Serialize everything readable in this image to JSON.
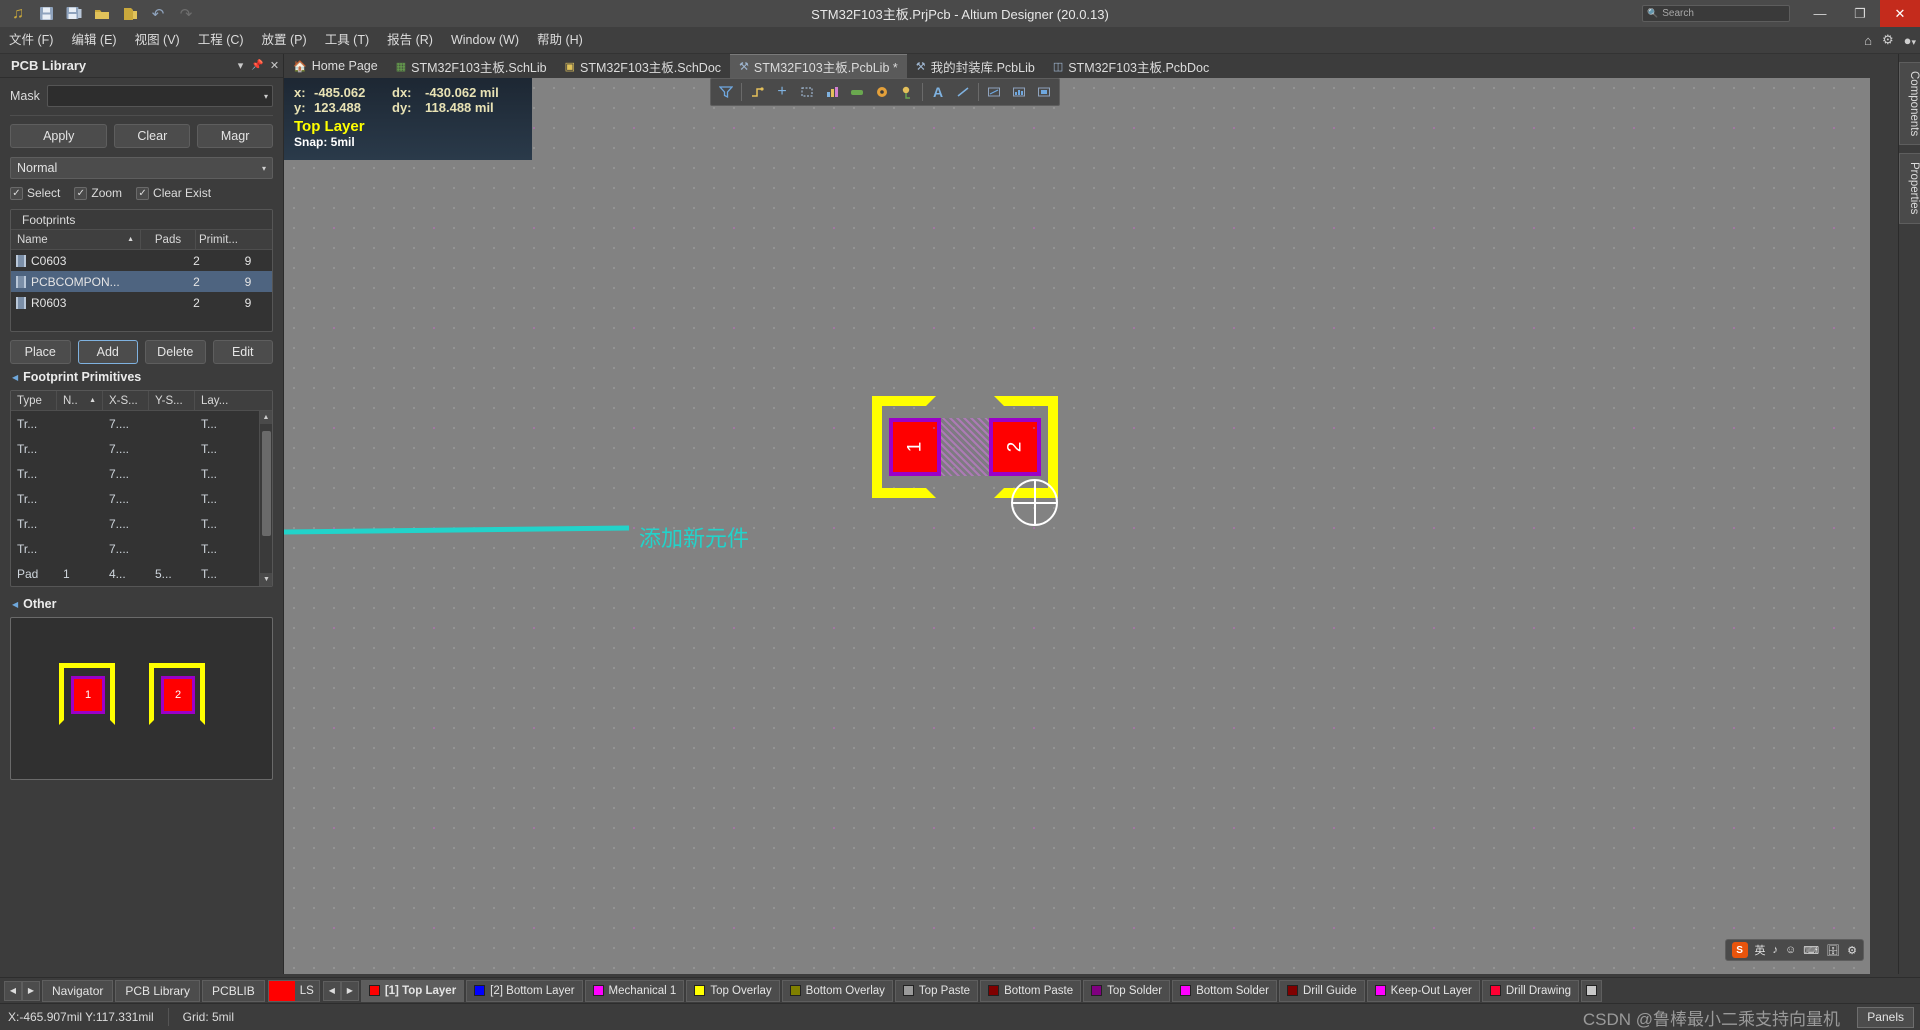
{
  "titlebar": {
    "title": "STM32F103主板.PrjPcb - Altium Designer (20.0.13)",
    "icons": [
      "altium-logo-icon",
      "save-icon",
      "save-all-icon",
      "open-folder-icon",
      "open-project-icon",
      "undo-icon",
      "redo-icon"
    ],
    "icon_glyphs": [
      "\u0001",
      "💾",
      "🖫",
      "📂",
      "🗈",
      "↶",
      "↷"
    ],
    "search_placeholder": "Search",
    "minimize": "—",
    "maximize": "❐",
    "close": "✕"
  },
  "menubar": {
    "items": [
      "文件 (F)",
      "编辑 (E)",
      "视图 (V)",
      "工程 (C)",
      "放置 (P)",
      "工具 (T)",
      "报告 (R)",
      "Window (W)",
      "帮助 (H)"
    ],
    "right_icons": [
      "home-icon",
      "gear-icon",
      "user-icon"
    ],
    "right_glyphs": [
      "⌂",
      "⚙",
      "▾"
    ]
  },
  "panel": {
    "title": "PCB Library",
    "dropdown_icon": "▾",
    "pin_icon": "📌",
    "close_icon": "✕",
    "mask_label": "Mask",
    "mask_value": "",
    "buttons": {
      "apply": "Apply",
      "clear": "Clear",
      "magnify": "Magr"
    },
    "mode_select": "Normal",
    "checkboxes": [
      {
        "label": "Select",
        "checked": true
      },
      {
        "label": "Zoom",
        "checked": true
      },
      {
        "label": "Clear Exist",
        "checked": true
      }
    ],
    "footprints_title": "Footprints",
    "footprints_columns": [
      "Name",
      "Pads",
      "Primit..."
    ],
    "footprints_sort_arrow": "▲",
    "footprints": [
      {
        "name": "C0603",
        "pads": "2",
        "primitives": "9",
        "selected": false
      },
      {
        "name": "PCBCOMPON...",
        "pads": "2",
        "primitives": "9",
        "selected": true
      },
      {
        "name": "R0603",
        "pads": "2",
        "primitives": "9",
        "selected": false
      }
    ],
    "action_buttons": [
      "Place",
      "Add",
      "Delete",
      "Edit"
    ],
    "action_highlighted": "Add",
    "primitives_section": "Footprint Primitives",
    "primitives_columns": [
      "Type",
      "N..",
      "X-S...",
      "Y-S...",
      "Lay..."
    ],
    "primitives_sort_arrow": "▲",
    "primitives": [
      {
        "type": "Tr...",
        "n": "",
        "xs": "7....",
        "ys": "",
        "layer": "T..."
      },
      {
        "type": "Tr...",
        "n": "",
        "xs": "7....",
        "ys": "",
        "layer": "T..."
      },
      {
        "type": "Tr...",
        "n": "",
        "xs": "7....",
        "ys": "",
        "layer": "T..."
      },
      {
        "type": "Tr...",
        "n": "",
        "xs": "7....",
        "ys": "",
        "layer": "T..."
      },
      {
        "type": "Tr...",
        "n": "",
        "xs": "7....",
        "ys": "",
        "layer": "T..."
      },
      {
        "type": "Tr...",
        "n": "",
        "xs": "7....",
        "ys": "",
        "layer": "T..."
      },
      {
        "type": "Pad",
        "n": "1",
        "xs": "4...",
        "ys": "5...",
        "layer": "T..."
      }
    ],
    "other_section": "Other",
    "preview_pad_labels": [
      "1",
      "2"
    ]
  },
  "doctabs": [
    {
      "label": "Home Page",
      "icon": "home-icon",
      "glyph": "🏠",
      "active": false
    },
    {
      "label": "STM32F103主板.SchLib",
      "icon": "schlib-icon",
      "glyph": "📗",
      "active": false
    },
    {
      "label": "STM32F103主板.SchDoc",
      "icon": "schdoc-icon",
      "glyph": "📘",
      "active": false
    },
    {
      "label": "STM32F103主板.PcbLib *",
      "icon": "pcblib-icon",
      "glyph": "🔧",
      "active": true
    },
    {
      "label": "我的封装库.PcbLib",
      "icon": "pcblib-icon",
      "glyph": "🔧",
      "active": false
    },
    {
      "label": "STM32F103主板.PcbDoc",
      "icon": "pcbdoc-icon",
      "glyph": "📐",
      "active": false
    }
  ],
  "canvas": {
    "info": {
      "x_label": "x:",
      "x_value": "-485.062",
      "dx_label": "dx:",
      "dx_value": "-430.062 mil",
      "y_label": "y:",
      "y_value": "123.488",
      "dy_label": "dy:",
      "dy_value": "118.488 mil",
      "layer": "Top Layer",
      "snap": "Snap: 5mil"
    },
    "toolbar_icons": [
      "filter-icon",
      "route-icon",
      "via-icon",
      "rectangle-icon",
      "polygon-icon",
      "fill-icon",
      "pad-icon",
      "keepout-icon",
      "text-icon",
      "line-icon",
      "dimension-icon",
      "array-icon",
      "component-icon"
    ],
    "toolbar_glyphs": [
      "▽",
      "↱",
      "＋",
      "□",
      "◧",
      "▬",
      "●",
      "❖",
      "A",
      "╱",
      "↔",
      "⌗",
      "▣"
    ],
    "pad_labels": [
      "1",
      "2"
    ],
    "annotation": "添加新元件"
  },
  "rightdock": {
    "items": [
      "Components",
      "Properties"
    ]
  },
  "ime": {
    "lang": "英",
    "glyphs": [
      "♪",
      "□",
      "⌨",
      "✂",
      "🗐",
      "⚙"
    ],
    "logo": "S"
  },
  "bottom": {
    "nav_arrows": [
      "◀",
      "▶"
    ],
    "panel_tabs": [
      "Navigator",
      "PCB Library",
      "PCBLIB"
    ],
    "ls_chip": {
      "color": "#ff0000",
      "label": "LS"
    },
    "layer_arrows": [
      "◀",
      "▶"
    ],
    "layers": [
      {
        "label": "[1] Top Layer",
        "color": "#ff0000",
        "active": true
      },
      {
        "label": "[2] Bottom Layer",
        "color": "#0000ff",
        "active": false
      },
      {
        "label": "Mechanical 1",
        "color": "#ff00ff",
        "active": false
      },
      {
        "label": "Top Overlay",
        "color": "#ffff00",
        "active": false
      },
      {
        "label": "Bottom Overlay",
        "color": "#808000",
        "active": false
      },
      {
        "label": "Top Paste",
        "color": "#9a9a9a",
        "active": false
      },
      {
        "label": "Bottom Paste",
        "color": "#800000",
        "active": false
      },
      {
        "label": "Top Solder",
        "color": "#800080",
        "active": false
      },
      {
        "label": "Bottom Solder",
        "color": "#ff00ff",
        "active": false
      },
      {
        "label": "Drill Guide",
        "color": "#800000",
        "active": false
      },
      {
        "label": "Keep-Out Layer",
        "color": "#ff00ff",
        "active": false
      },
      {
        "label": "Drill Drawing",
        "color": "#ff0033",
        "active": false
      }
    ],
    "trailing_swatch": "#c8c8c8"
  },
  "statusbar": {
    "coords": "X:-465.907mil Y:117.331mil",
    "grid": "Grid: 5mil",
    "watermark": "CSDN @鲁棒最小二乘支持向量机",
    "panels_button": "Panels"
  }
}
